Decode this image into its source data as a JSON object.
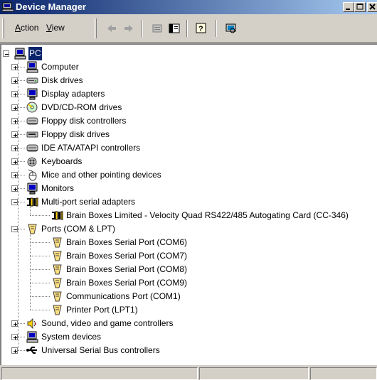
{
  "window": {
    "title": "Device Manager"
  },
  "menu": {
    "action": "Action",
    "action_key": "A",
    "view": "View",
    "view_key": "V"
  },
  "toolbar": {
    "buttons": [
      "back-icon",
      "forward-icon",
      "properties-icon",
      "show-hide-tree-icon",
      "help-icon",
      "scan-hardware-icon"
    ]
  },
  "tree": {
    "root": {
      "label": "PC",
      "icon": "computer-icon",
      "selected": true,
      "expanded": true
    },
    "items": [
      {
        "label": "Computer",
        "icon": "computer-icon",
        "level": 1,
        "expander": "plus"
      },
      {
        "label": "Disk drives",
        "icon": "disk-drive-icon",
        "level": 1,
        "expander": "plus"
      },
      {
        "label": "Display adapters",
        "icon": "monitor-icon",
        "level": 1,
        "expander": "plus"
      },
      {
        "label": "DVD/CD-ROM drives",
        "icon": "cdrom-icon",
        "level": 1,
        "expander": "plus"
      },
      {
        "label": "Floppy disk controllers",
        "icon": "controller-icon",
        "level": 1,
        "expander": "plus"
      },
      {
        "label": "Floppy disk drives",
        "icon": "floppy-drive-icon",
        "level": 1,
        "expander": "plus"
      },
      {
        "label": "IDE ATA/ATAPI controllers",
        "icon": "controller-icon",
        "level": 1,
        "expander": "plus"
      },
      {
        "label": "Keyboards",
        "icon": "keyboard-icon",
        "level": 1,
        "expander": "plus"
      },
      {
        "label": "Mice and other pointing devices",
        "icon": "mouse-icon",
        "level": 1,
        "expander": "plus"
      },
      {
        "label": "Monitors",
        "icon": "monitor-icon",
        "level": 1,
        "expander": "plus"
      },
      {
        "label": "Multi-port serial adapters",
        "icon": "serial-adapter-icon",
        "level": 1,
        "expander": "minus"
      },
      {
        "label": "Brain Boxes Limited - Velocity Quad RS422/485 Autogating Card (CC-346)",
        "icon": "serial-adapter-icon",
        "level": 2,
        "expander": "none"
      },
      {
        "label": "Ports (COM & LPT)",
        "icon": "port-icon",
        "level": 1,
        "expander": "minus"
      },
      {
        "label": "Brain Boxes Serial Port (COM6)",
        "icon": "port-icon",
        "level": 2,
        "expander": "none"
      },
      {
        "label": "Brain Boxes Serial Port (COM7)",
        "icon": "port-icon",
        "level": 2,
        "expander": "none"
      },
      {
        "label": "Brain Boxes Serial Port (COM8)",
        "icon": "port-icon",
        "level": 2,
        "expander": "none"
      },
      {
        "label": "Brain Boxes Serial Port (COM9)",
        "icon": "port-icon",
        "level": 2,
        "expander": "none"
      },
      {
        "label": "Communications Port (COM1)",
        "icon": "port-icon",
        "level": 2,
        "expander": "none"
      },
      {
        "label": "Printer Port (LPT1)",
        "icon": "port-icon",
        "level": 2,
        "expander": "none"
      },
      {
        "label": "Sound, video and game controllers",
        "icon": "speaker-icon",
        "level": 1,
        "expander": "plus"
      },
      {
        "label": "System devices",
        "icon": "computer-icon",
        "level": 1,
        "expander": "plus"
      },
      {
        "label": "Universal Serial Bus controllers",
        "icon": "usb-icon",
        "level": 1,
        "expander": "plus"
      }
    ]
  },
  "statusbar": {
    "panels": [
      "",
      "",
      ""
    ]
  },
  "colors": {
    "title_start": "#0a246a",
    "title_end": "#a6caf0",
    "selection": "#0a246a",
    "face": "#d4d0c8"
  }
}
